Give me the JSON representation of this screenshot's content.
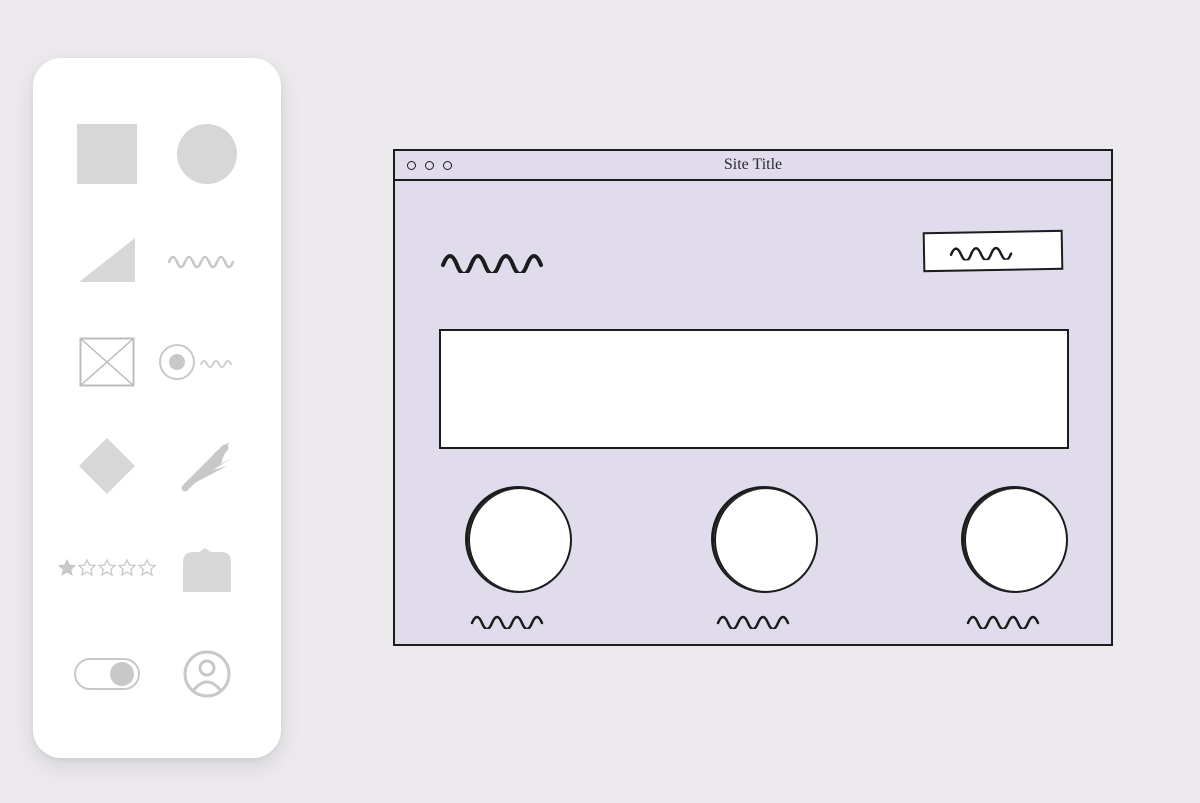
{
  "palette": {
    "shapes": [
      {
        "name": "square-shape"
      },
      {
        "name": "circle-shape"
      },
      {
        "name": "triangle-shape"
      },
      {
        "name": "squiggle-text-shape"
      },
      {
        "name": "image-placeholder-shape"
      },
      {
        "name": "radio-button-shape"
      },
      {
        "name": "diamond-shape"
      },
      {
        "name": "arrow-cursor-shape"
      },
      {
        "name": "star-rating-shape"
      },
      {
        "name": "tab-chip-shape"
      },
      {
        "name": "toggle-switch-shape"
      },
      {
        "name": "user-avatar-shape"
      }
    ]
  },
  "wireframe": {
    "title": "Site Title",
    "logo_placeholder": "squiggle",
    "cta_placeholder": "squiggle",
    "hero_placeholder": "rectangle",
    "features": [
      {
        "label_placeholder": "squiggle"
      },
      {
        "label_placeholder": "squiggle"
      },
      {
        "label_placeholder": "squiggle"
      }
    ]
  },
  "colors": {
    "canvas_bg": "#eceaed",
    "panel_bg": "#ffffff",
    "wireframe_bg": "#e1dcec",
    "stroke": "#1c1c1c",
    "shape_fill": "#d7d7d7",
    "shape_stroke": "#bdbdbd"
  }
}
